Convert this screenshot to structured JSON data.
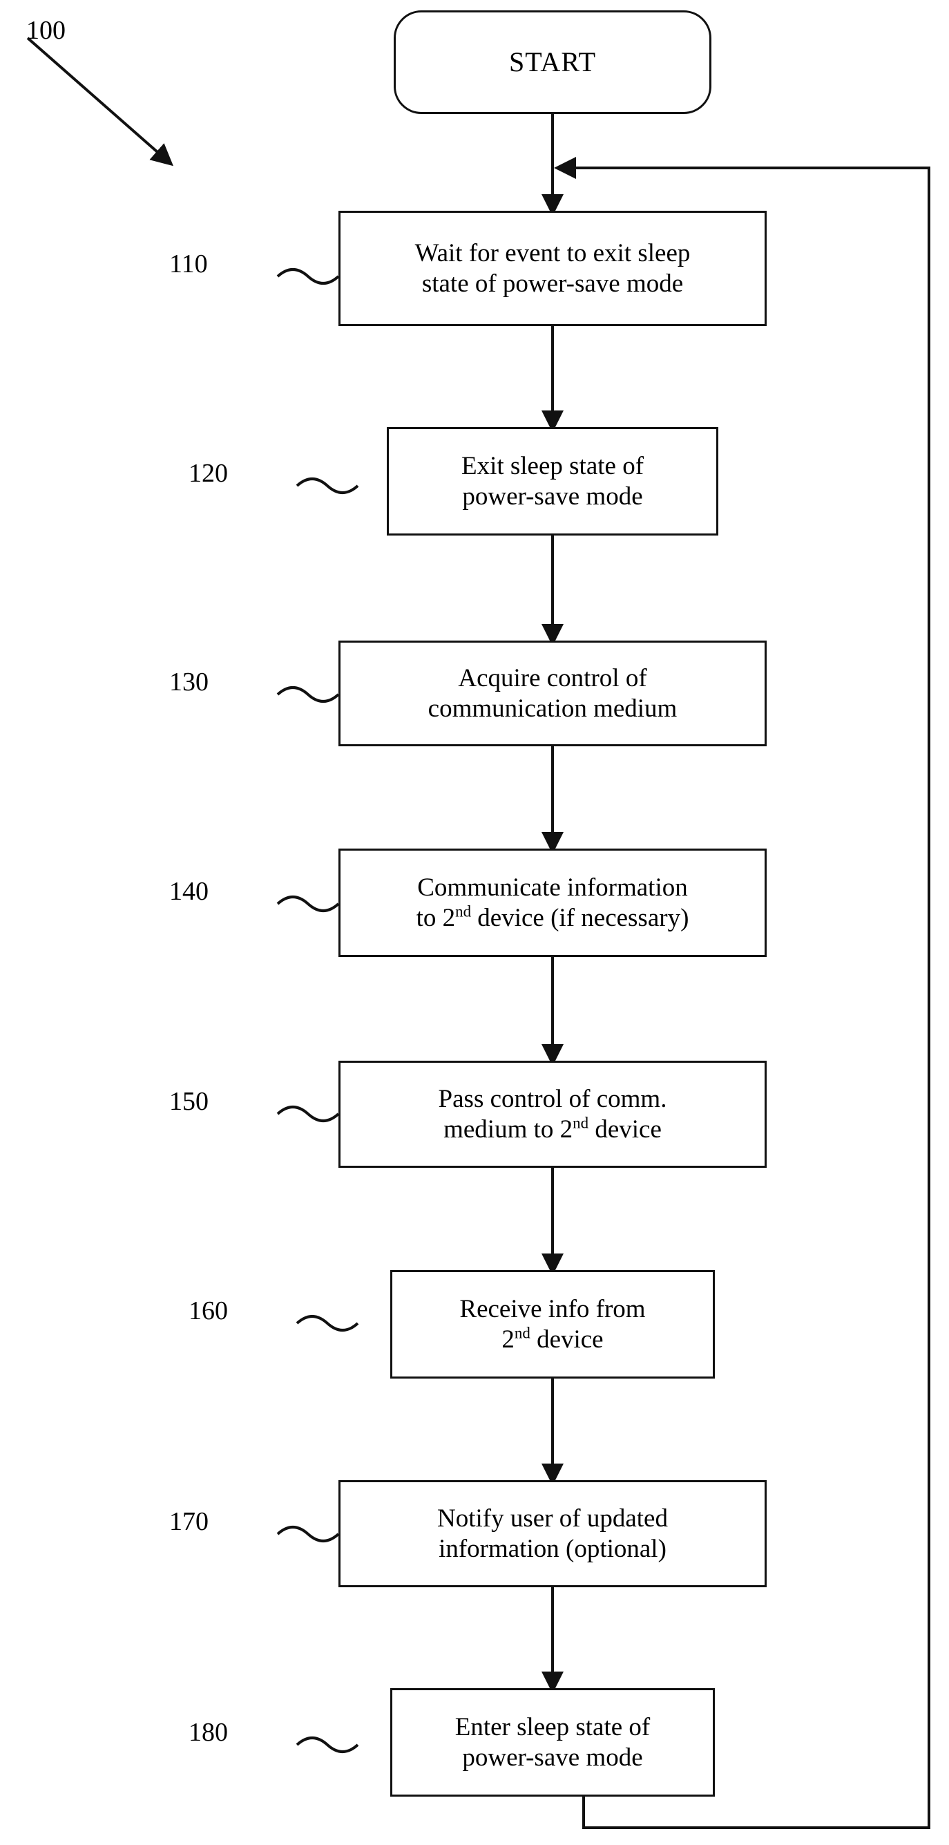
{
  "figure": {
    "figure_number": "100",
    "start_label": "START",
    "nodes": [
      {
        "ref": "110",
        "line1": "Wait for event to exit sleep",
        "line2": "state of power-save mode"
      },
      {
        "ref": "120",
        "line1": "Exit sleep state of",
        "line2": "power-save mode"
      },
      {
        "ref": "130",
        "line1": "Acquire control of",
        "line2": "communication medium"
      },
      {
        "ref": "140",
        "line1": "Communicate information",
        "line2_pre": "to 2",
        "line2_sup": "nd",
        "line2_post": " device (if necessary)"
      },
      {
        "ref": "150",
        "line1": "Pass control of comm.",
        "line2_pre": "medium to 2",
        "line2_sup": "nd",
        "line2_post": " device"
      },
      {
        "ref": "160",
        "line1": "Receive info from",
        "line2_pre": "2",
        "line2_sup": "nd",
        "line2_post": " device"
      },
      {
        "ref": "170",
        "line1": "Notify user of updated",
        "line2": "information (optional)"
      },
      {
        "ref": "180",
        "line1": "Enter sleep state of",
        "line2": "power-save mode"
      }
    ]
  }
}
